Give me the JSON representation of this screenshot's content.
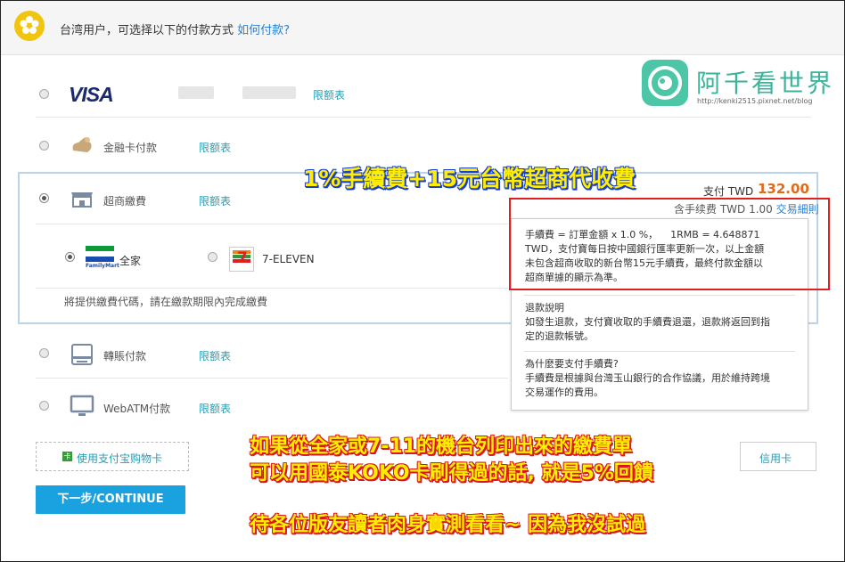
{
  "header": {
    "text": "台湾用户，可选择以下的付款方式",
    "link": "如何付款?"
  },
  "watermark": {
    "title": "阿千看世界",
    "url": "http://kenki2515.pixnet.net/blog"
  },
  "methods": {
    "visa": {
      "brand": "VISA",
      "link": "限额表"
    },
    "debit": {
      "label": "金融卡付款",
      "link": "限额表"
    },
    "store": {
      "label": "超商繳費",
      "link": "限额表",
      "sub_familymart": "全家",
      "familymart_logo": "FamilyMart",
      "sub_seven": "7-ELEVEN",
      "note": "將提供繳費代碼，請在繳款期限內完成繳費"
    },
    "transfer": {
      "label": "轉賬付款",
      "link": "限额表"
    },
    "webatm": {
      "label": "WebATM付款",
      "link": "限额表"
    }
  },
  "payment": {
    "pay_label": "支付 TWD",
    "amount": "132.00",
    "fee_text": "含手续费 TWD 1.00",
    "fee_link": "交易細則"
  },
  "popup": {
    "line1": "手續費 = 訂單金額 x 1.0 %，    1RMB = 4.648871",
    "line2": "TWD，支付寶每日按中國銀行匯率更新一次，以上金額",
    "line3": "未包含超商收取的新台幣15元手續費，最終付款金額以",
    "line4": "超商單據的顯示為準。",
    "refund_title": "退款說明",
    "refund_line1": "如發生退款，支付寶收取的手續費退還，退款將返回到指",
    "refund_line2": "定的退款帳號。",
    "why_title": "為什麼要支付手續費?",
    "why_line1": "手續費是根據與台灣玉山銀行的合作協議，用於維持跨境",
    "why_line2": "交易運作的費用。"
  },
  "cards": {
    "shopping_card": "使用支付宝购物卡",
    "right_card": "信用卡"
  },
  "next_button": "下一步/CONTINUE",
  "annotations": {
    "banner1": "1%手續費+15元台幣超商代收費",
    "banner2_line1": "如果從全家或7-11的機台列印出來的繳費單",
    "banner2_line2": "可以用國泰KOKO卡刷得過的話, 就是5%回饋",
    "banner3": "待各位版友讀者肉身實測看看~ 因為我沒試過"
  }
}
